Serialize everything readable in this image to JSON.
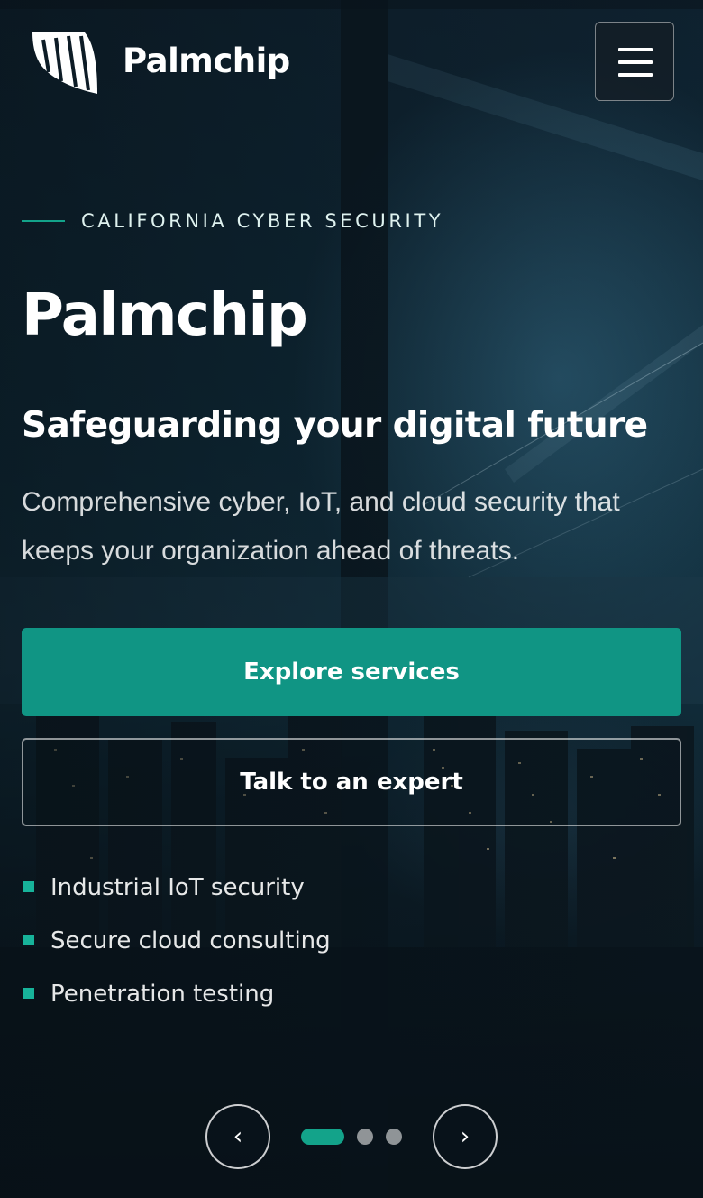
{
  "header": {
    "brand": "Palmchip",
    "logo_icon": "palm-leaf-logo-icon",
    "menu_icon": "hamburger-menu-icon"
  },
  "hero": {
    "eyebrow": "CALIFORNIA CYBER SECURITY",
    "title": "Palmchip",
    "subtitle": "Safeguarding your digital future",
    "description": "Comprehensive cyber, IoT, and cloud security that keeps your organization ahead of threats.",
    "primary_cta": "Explore services",
    "secondary_cta": "Talk to an expert",
    "features": [
      "Industrial IoT security",
      "Secure cloud consulting",
      "Penetration testing"
    ]
  },
  "carousel": {
    "prev_label": "‹",
    "next_label": "›",
    "slide_count": 3,
    "active_slide": 1
  },
  "colors": {
    "accent": "#109584",
    "bullet": "#17b39a",
    "background": "#0b1a24"
  }
}
